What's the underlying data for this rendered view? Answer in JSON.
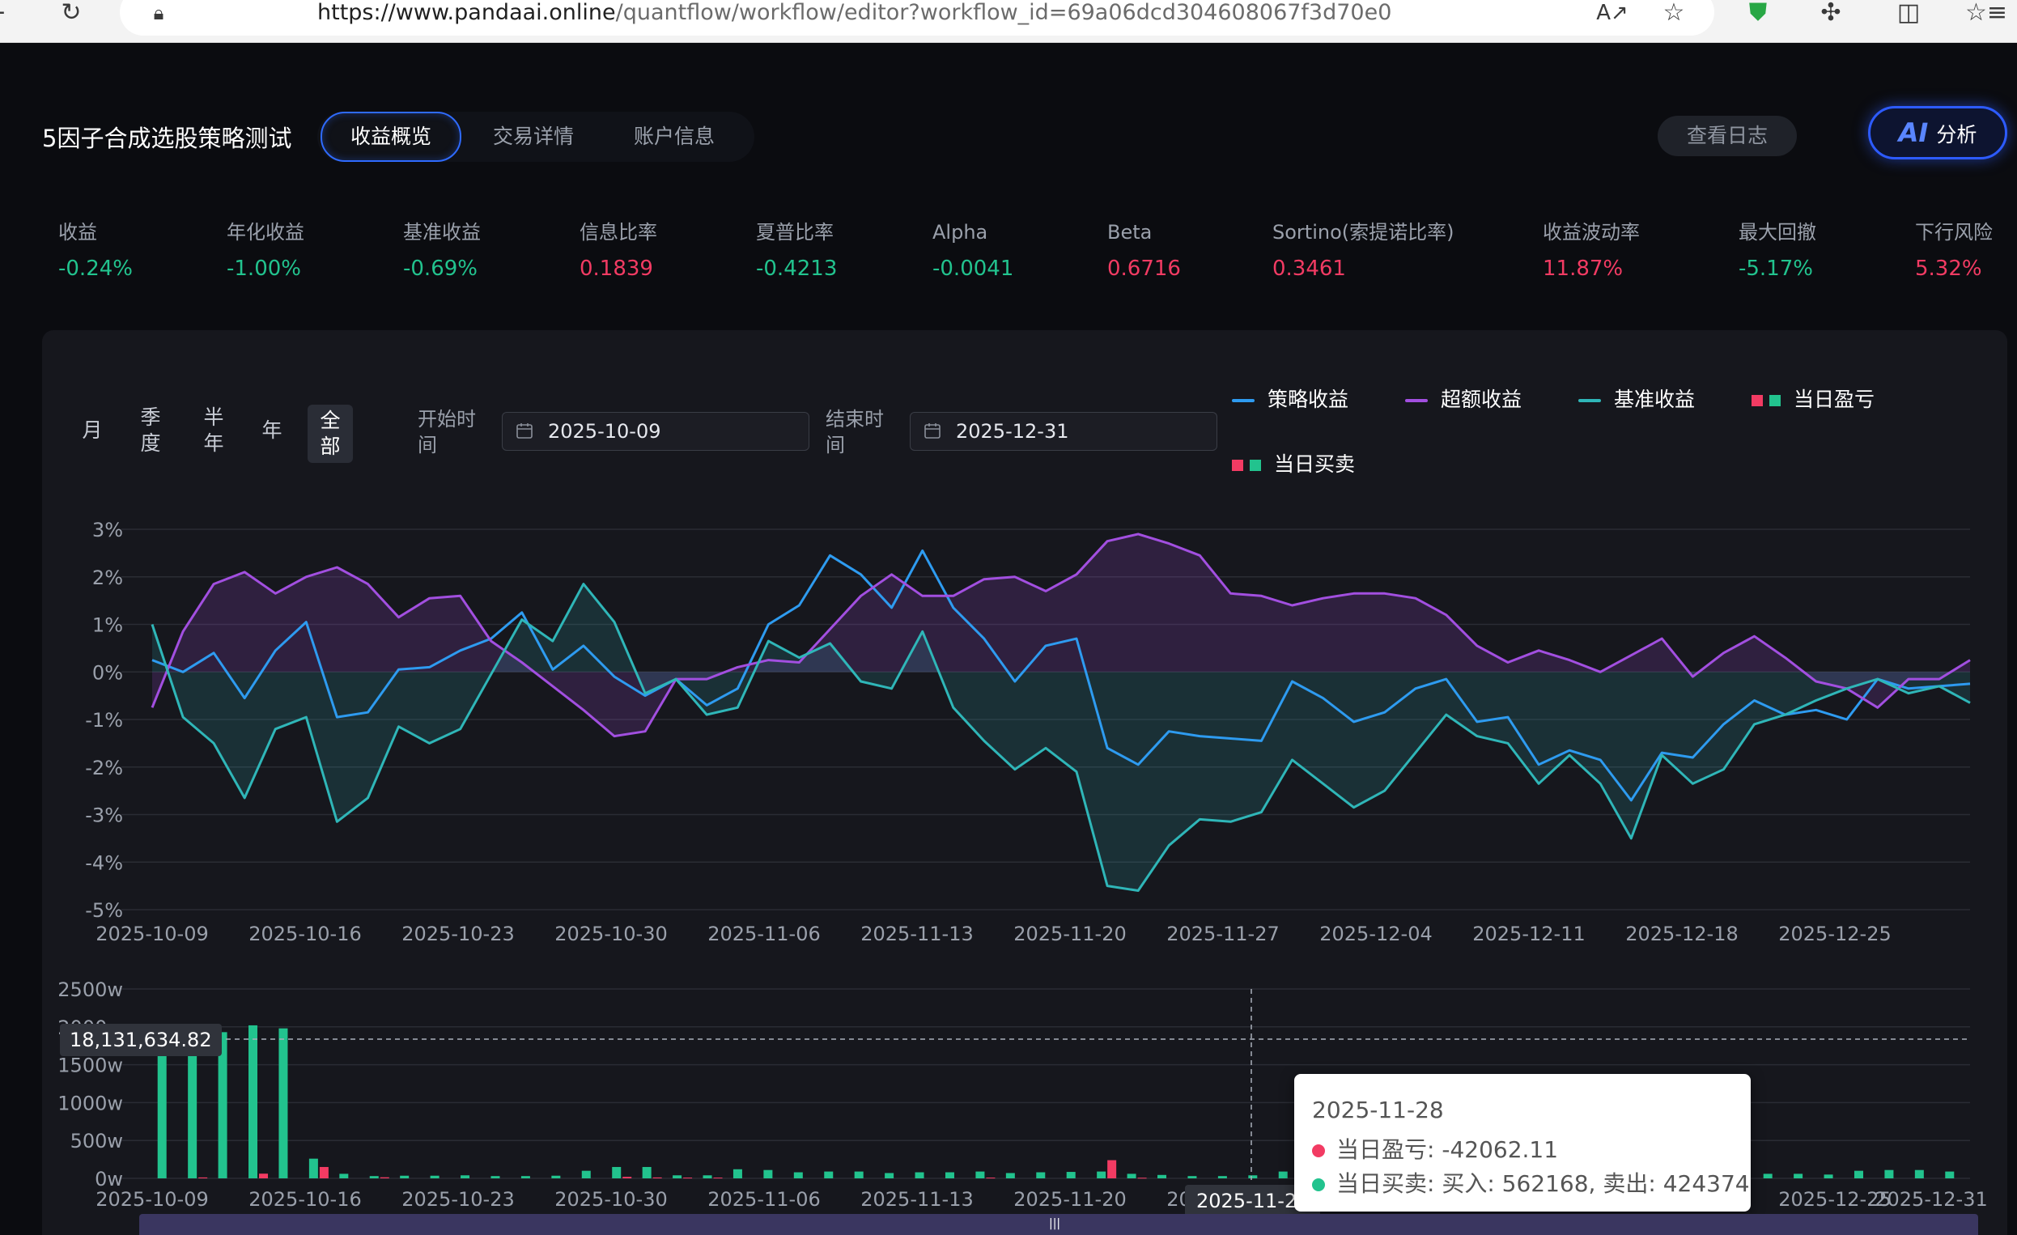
{
  "browser": {
    "url_host": "https://www.pandaai.online",
    "url_path": "/quantflow/workflow/editor?workflow_id=69a06dcd304608067f3d70e0",
    "icons": [
      "reload-icon",
      "lock-icon",
      "read-aloud-icon",
      "favorite-icon",
      "shield-icon",
      "extensions-icon",
      "split-screen-icon",
      "favorites-bar-icon"
    ]
  },
  "header": {
    "title": "5因子合成选股策略测试",
    "tabs": [
      "收益概览",
      "交易详情",
      "账户信息"
    ],
    "log_button": "查看日志",
    "ai_button": {
      "badge": "AI",
      "label": "分析"
    }
  },
  "metrics": [
    {
      "label": "收益",
      "value": "-0.24%",
      "color": "green"
    },
    {
      "label": "年化收益",
      "value": "-1.00%",
      "color": "green"
    },
    {
      "label": "基准收益",
      "value": "-0.69%",
      "color": "green"
    },
    {
      "label": "信息比率",
      "value": "0.1839",
      "color": "red"
    },
    {
      "label": "夏普比率",
      "value": "-0.4213",
      "color": "green"
    },
    {
      "label": "Alpha",
      "value": "-0.0041",
      "color": "green"
    },
    {
      "label": "Beta",
      "value": "0.6716",
      "color": "red"
    },
    {
      "label": "Sortino(索提诺比率)",
      "value": "0.3461",
      "color": "red"
    },
    {
      "label": "收益波动率",
      "value": "11.87%",
      "color": "red"
    },
    {
      "label": "最大回撤",
      "value": "-5.17%",
      "color": "green"
    },
    {
      "label": "下行风险",
      "value": "5.32%",
      "color": "red"
    }
  ],
  "filters": {
    "periods": [
      "月",
      "季度",
      "半年",
      "年",
      "全部"
    ],
    "active_period": "全部",
    "start_label": "开始时间",
    "start_value": "2025-10-09",
    "end_label": "结束时间",
    "end_value": "2025-12-31"
  },
  "legend": {
    "strategy": "策略收益",
    "excess": "超额收益",
    "benchmark": "基准收益",
    "daily_pnl": "当日盈亏",
    "daily_trade": "当日买卖"
  },
  "colors": {
    "strategy": "#2e9bf0",
    "excess": "#a24fe0",
    "benchmark": "#2fb6b8",
    "up": "#f23b63",
    "down": "#22c38e",
    "panel": "#16171d"
  },
  "chart_data": [
    {
      "type": "line",
      "x_ticks": [
        "2025-10-09",
        "2025-10-16",
        "2025-10-23",
        "2025-10-30",
        "2025-11-06",
        "2025-11-13",
        "2025-11-20",
        "2025-11-27",
        "2025-12-04",
        "2025-12-11",
        "2025-12-18",
        "2025-12-25"
      ],
      "ylim": [
        -5,
        3
      ],
      "y_ticks": [
        "3%",
        "2%",
        "1%",
        "0%",
        "-1%",
        "-2%",
        "-3%",
        "-4%",
        "-5%"
      ],
      "grid": true,
      "x_start": "2025-10-09",
      "x_end": "2025-12-31",
      "series": [
        {
          "name": "策略收益",
          "values": [
            0.25,
            0.0,
            0.4,
            -0.55,
            0.45,
            1.05,
            -0.95,
            -0.85,
            0.05,
            0.1,
            0.45,
            0.7,
            1.25,
            0.05,
            0.55,
            -0.1,
            -0.5,
            -0.15,
            -0.7,
            -0.35,
            1.0,
            1.4,
            2.45,
            2.05,
            1.35,
            2.55,
            1.35,
            0.7,
            -0.2,
            0.55,
            0.7,
            -1.6,
            -1.95,
            -1.25,
            -1.35,
            -1.4,
            -1.45,
            -0.2,
            -0.55,
            -1.05,
            -0.85,
            -0.35,
            -0.15,
            -1.05,
            -0.95,
            -1.95,
            -1.65,
            -1.85,
            -2.7,
            -1.7,
            -1.8,
            -1.1,
            -0.6,
            -0.9,
            -0.8,
            -1.0,
            -0.15,
            -0.35,
            -0.3,
            -0.25
          ]
        },
        {
          "name": "超额收益",
          "values": [
            -0.75,
            0.85,
            1.85,
            2.1,
            1.65,
            2.0,
            2.2,
            1.85,
            1.15,
            1.55,
            1.6,
            0.65,
            0.2,
            -0.3,
            -0.8,
            -1.35,
            -1.25,
            -0.15,
            -0.15,
            0.1,
            0.25,
            0.2,
            0.9,
            1.6,
            2.05,
            1.6,
            1.6,
            1.95,
            2.0,
            1.7,
            2.05,
            2.75,
            2.9,
            2.7,
            2.45,
            1.65,
            1.6,
            1.4,
            1.55,
            1.65,
            1.65,
            1.55,
            1.2,
            0.55,
            0.2,
            0.45,
            0.25,
            0.0,
            0.35,
            0.7,
            -0.1,
            0.4,
            0.75,
            0.3,
            -0.2,
            -0.35,
            -0.75,
            -0.15,
            -0.15,
            0.25
          ]
        },
        {
          "name": "基准收益",
          "values": [
            1.0,
            -0.95,
            -1.5,
            -2.65,
            -1.2,
            -0.95,
            -3.15,
            -2.65,
            -1.15,
            -1.5,
            -1.2,
            -0.05,
            1.1,
            0.65,
            1.85,
            1.05,
            -0.45,
            -0.15,
            -0.9,
            -0.75,
            0.65,
            0.3,
            0.6,
            -0.2,
            -0.35,
            0.85,
            -0.75,
            -1.45,
            -2.05,
            -1.6,
            -2.1,
            -4.5,
            -4.6,
            -3.65,
            -3.1,
            -3.15,
            -2.95,
            -1.85,
            -2.35,
            -2.85,
            -2.5,
            -1.7,
            -0.9,
            -1.35,
            -1.5,
            -2.35,
            -1.75,
            -2.35,
            -3.5,
            -1.75,
            -2.35,
            -2.05,
            -1.1,
            -0.9,
            -0.6,
            -0.35,
            -0.15,
            -0.45,
            -0.3,
            -0.65
          ]
        }
      ]
    },
    {
      "type": "bar",
      "x_ticks": [
        "2025-10-09",
        "2025-10-16",
        "2025-10-23",
        "2025-10-30",
        "2025-11-06",
        "2025-11-13",
        "2025-11-20",
        "2025-11-27",
        "2025-12-04",
        "2025-12-11",
        "2025-12-18",
        "2025-12-25",
        "2025-12-31"
      ],
      "ylim": [
        0,
        2500
      ],
      "y_ticks": [
        "2500w",
        "2000w",
        "1500w",
        "1000w",
        "500w",
        "0w"
      ],
      "series": [
        {
          "name": "当日盈亏",
          "values": [
            0,
            12,
            0,
            62,
            0,
            150,
            0,
            14,
            0,
            0,
            0,
            0,
            0,
            0,
            0,
            20,
            12,
            10,
            10,
            0,
            0,
            0,
            0,
            0,
            0,
            0,
            0,
            10,
            0,
            0,
            0,
            240,
            8,
            0,
            0,
            0,
            0,
            0,
            0,
            0,
            0,
            0,
            0,
            0,
            0,
            0,
            0,
            0,
            0,
            0,
            0,
            0,
            0,
            0,
            0,
            0,
            0,
            0,
            0,
            0
          ]
        },
        {
          "name": "当日买卖",
          "values": [
            1860,
            1980,
            1930,
            2020,
            1980,
            260,
            60,
            30,
            35,
            35,
            40,
            30,
            30,
            35,
            100,
            150,
            150,
            40,
            40,
            120,
            110,
            80,
            90,
            90,
            70,
            80,
            80,
            90,
            70,
            80,
            85,
            90,
            60,
            45,
            30,
            30,
            40,
            90,
            60,
            70,
            50,
            60,
            50,
            60,
            40,
            40,
            60,
            60,
            70,
            60,
            90,
            60,
            60,
            60,
            60,
            50,
            100,
            110,
            110,
            90
          ]
        }
      ],
      "crosshair_y_label": "18,131,634.82",
      "crosshair_x_label": "2025-11-28",
      "tooltip": {
        "date": "2025-11-28",
        "pnl_label": "当日盈亏: -42062.11",
        "trade_label": "当日买卖: 买入: 562168, 卖出: 424374"
      }
    }
  ]
}
